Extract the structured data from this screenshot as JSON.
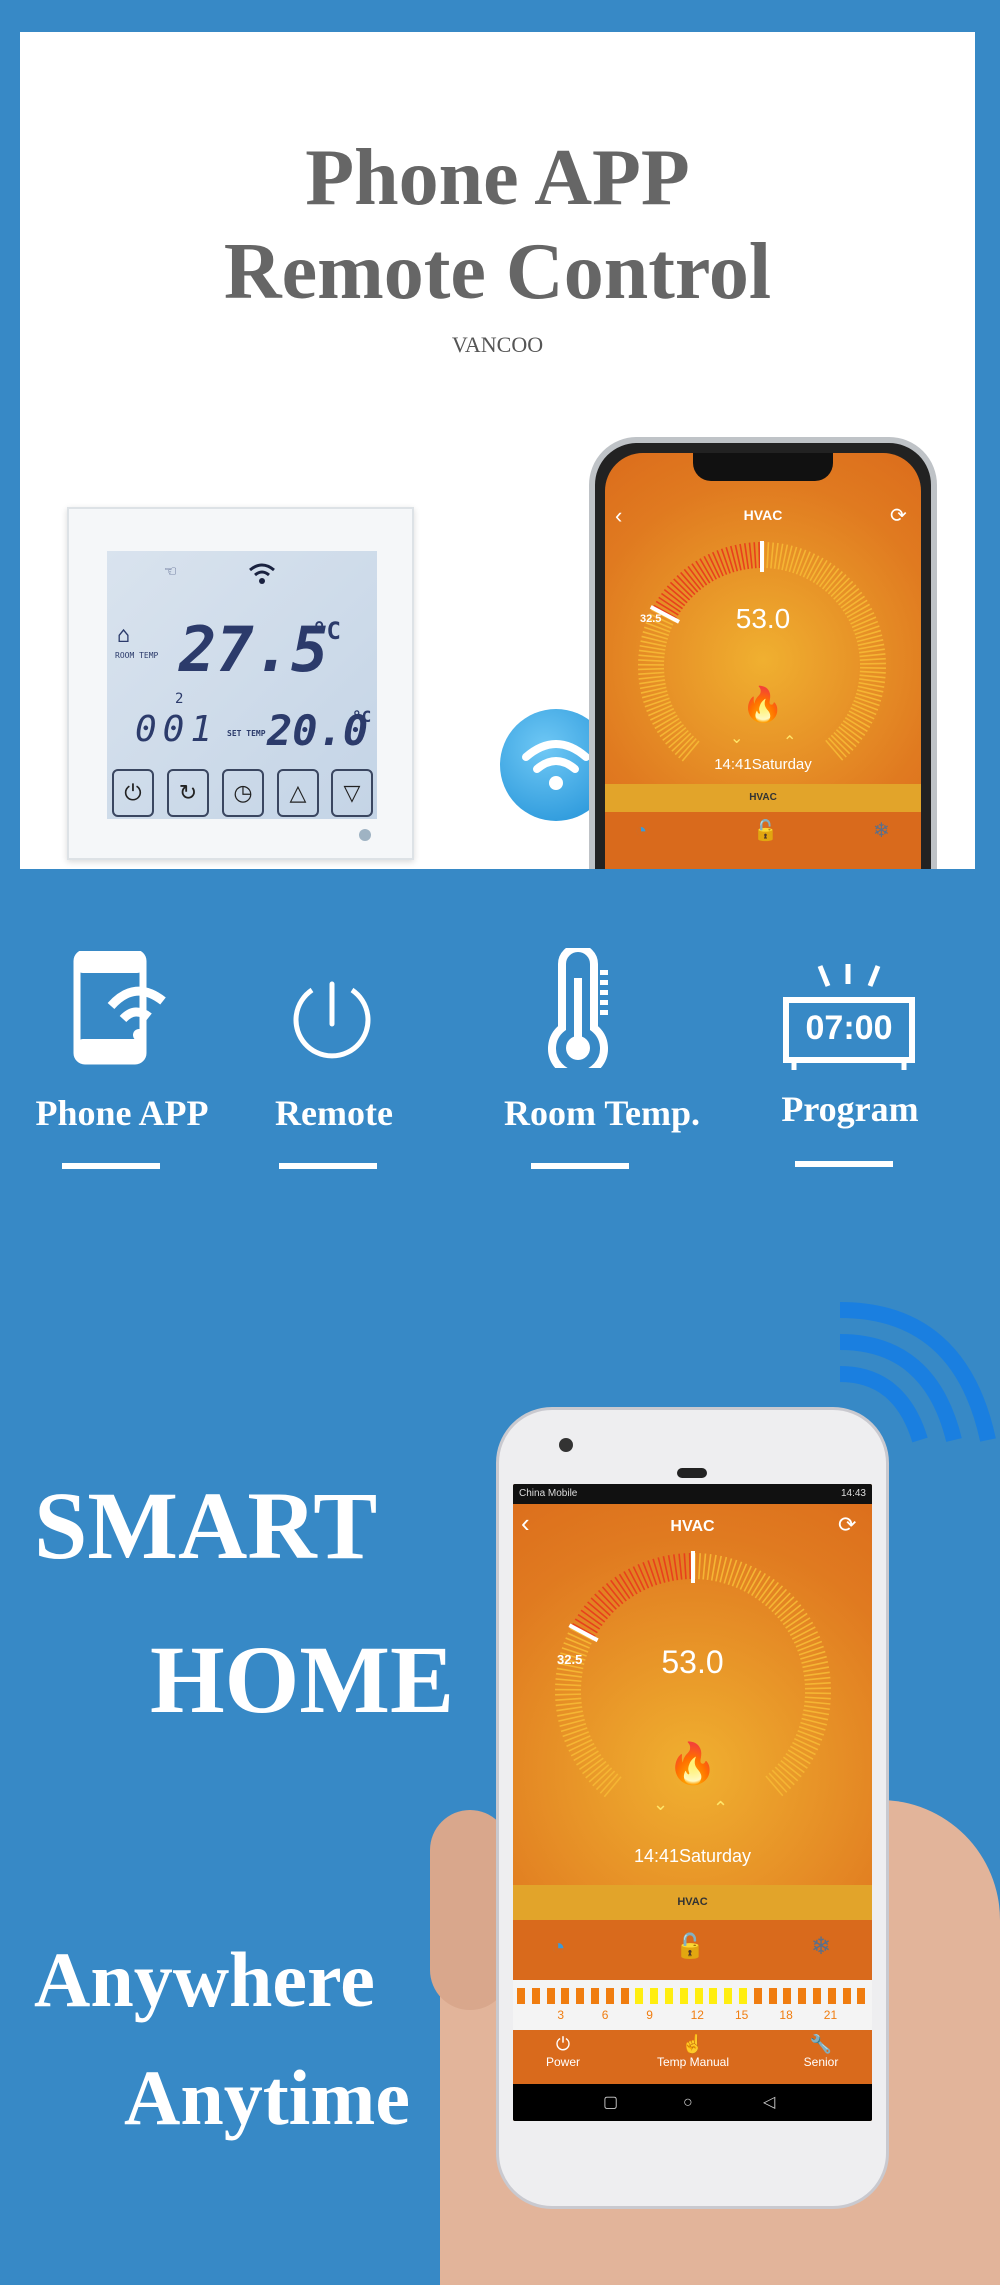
{
  "header": {
    "title_line1": "Phone APP",
    "title_line2": "Remote Control",
    "brand": "VANCOO"
  },
  "thermostat": {
    "room_temp": "27.5",
    "room_unit": "°C",
    "room_label": "ROOM TEMP",
    "program_index": "2",
    "program_code": "001",
    "set_label": "SET TEMP",
    "set_temp": "20.0",
    "set_unit": "°C",
    "buttons": [
      {
        "icon": "power-icon",
        "glyph": "⏻"
      },
      {
        "icon": "mode-cycle-icon",
        "glyph": "↻"
      },
      {
        "icon": "clock-icon",
        "glyph": "◷"
      },
      {
        "icon": "up-arrow-icon",
        "glyph": "△"
      },
      {
        "icon": "down-arrow-icon",
        "glyph": "▽"
      }
    ]
  },
  "app": {
    "title": "HVAC",
    "current_value": "53.0",
    "set_value": "32.5",
    "time_day": "14:41Saturday",
    "mode_bar": "HVAC",
    "status_carrier": "China Mobile",
    "status_time": "14:43",
    "colors": {
      "bg": "#e07a20",
      "active_arc": "#e8401c",
      "arc": "#f5b533",
      "mode_bar": "#e2a42a",
      "lock": "#7cc43a",
      "timer": "#3a9ad9",
      "snow": "#5a6f8a"
    },
    "timeline": {
      "labels": [
        "3",
        "6",
        "9",
        "12",
        "15",
        "18",
        "21"
      ],
      "heated_hours_from": 8,
      "heated_hours_to": 15
    },
    "nav": [
      {
        "label": "Power",
        "icon": "power-icon"
      },
      {
        "label": "Temp Manual",
        "icon": "hand-icon"
      },
      {
        "label": "Senior",
        "icon": "wrench-icon"
      }
    ]
  },
  "features": [
    {
      "label": "Phone APP",
      "icon": "phone-wifi-icon"
    },
    {
      "label": "Remote",
      "icon": "power-icon"
    },
    {
      "label": "Room Temp.",
      "icon": "thermometer-icon"
    },
    {
      "label": "Program",
      "icon": "alarm-clock-icon",
      "clock_text": "07:00"
    }
  ],
  "slogans": {
    "line1": "SMART",
    "line2": "HOME",
    "line3": "Anywhere",
    "line4": "Anytime"
  }
}
